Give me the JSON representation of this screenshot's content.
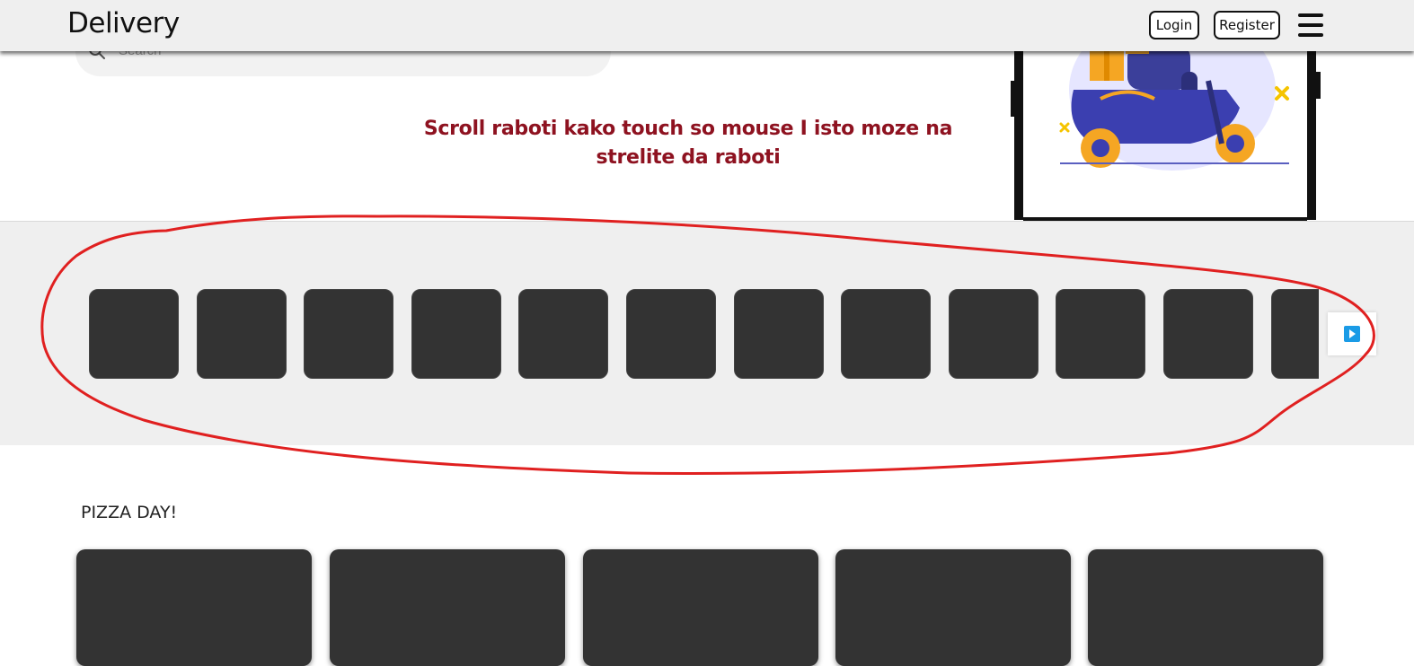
{
  "header": {
    "brand": "Delivery",
    "login_label": "Login",
    "register_label": "Register",
    "menu_icon": "hamburger-menu-icon"
  },
  "hero": {
    "search_placeholder": "Search",
    "message": "Scroll raboti kako touch so mouse I isto moze na strelite da raboti",
    "illustration": "delivery-scooter-phone-illustration"
  },
  "categories": {
    "tile_count": 12,
    "next_icon": "play-arrow-icon",
    "colors": {
      "tile": "#333333",
      "strip": "#efefef",
      "arrow": "#1a9be6"
    }
  },
  "pizza_section": {
    "title": "PIZZA DAY!",
    "card_count": 5
  },
  "annotation": {
    "color": "#e02020",
    "shape": "hand-drawn-ellipse"
  }
}
